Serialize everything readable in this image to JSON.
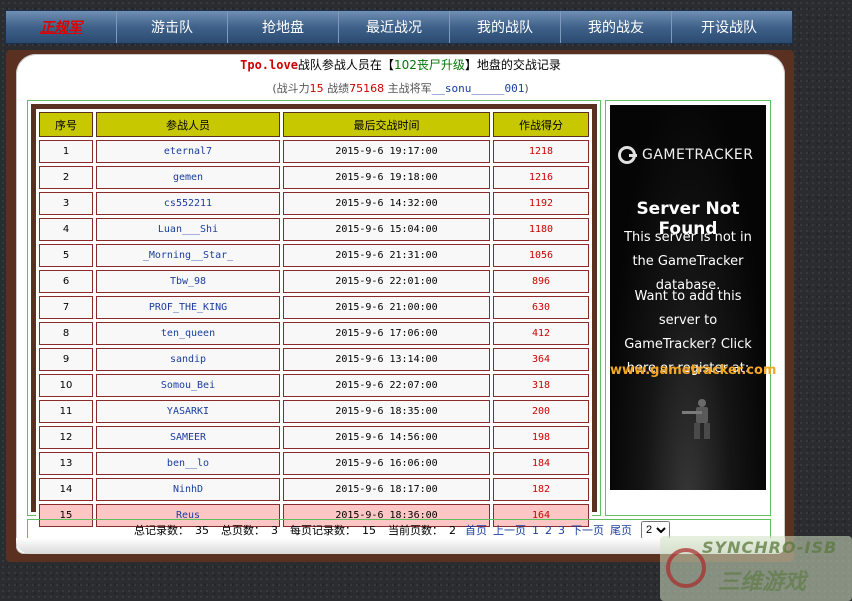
{
  "nav": {
    "items": [
      {
        "label": "正规军",
        "brand": true
      },
      {
        "label": "游击队"
      },
      {
        "label": "抢地盘"
      },
      {
        "label": "最近战况"
      },
      {
        "label": "我的战队"
      },
      {
        "label": "我的战友"
      },
      {
        "label": "开设战队"
      }
    ]
  },
  "header": {
    "team": "Tpo.love",
    "text1": "战队参战人员在【",
    "map": "102丧尸升级",
    "text2": "】地盘的交战记录"
  },
  "subheader": {
    "open": "(战斗力",
    "power": "15",
    "record_label": " 战绩",
    "record": "75168",
    "general_label": " 主战将军",
    "general": "__sonu_____001",
    "close": ")"
  },
  "table": {
    "columns": [
      "序号",
      "参战人员",
      "最后交战时间",
      "作战得分"
    ],
    "rows": [
      {
        "idx": "1",
        "player": "eternal7",
        "time": "2015-9-6 19:17:00",
        "score": "1218"
      },
      {
        "idx": "2",
        "player": "gemen",
        "time": "2015-9-6 19:18:00",
        "score": "1216"
      },
      {
        "idx": "3",
        "player": "cs552211",
        "time": "2015-9-6 14:32:00",
        "score": "1192"
      },
      {
        "idx": "4",
        "player": "Luan___Shi",
        "time": "2015-9-6 15:04:00",
        "score": "1180"
      },
      {
        "idx": "5",
        "player": "_Morning__Star_",
        "time": "2015-9-6 21:31:00",
        "score": "1056"
      },
      {
        "idx": "6",
        "player": "Tbw_98",
        "time": "2015-9-6 22:01:00",
        "score": "896"
      },
      {
        "idx": "7",
        "player": "PROF_THE_KING",
        "time": "2015-9-6 21:00:00",
        "score": "630"
      },
      {
        "idx": "8",
        "player": "ten_queen",
        "time": "2015-9-6 17:06:00",
        "score": "412"
      },
      {
        "idx": "9",
        "player": "sandip",
        "time": "2015-9-6 13:14:00",
        "score": "364"
      },
      {
        "idx": "10",
        "player": "Somou_Bei",
        "time": "2015-9-6 22:07:00",
        "score": "318"
      },
      {
        "idx": "11",
        "player": "YASARKI",
        "time": "2015-9-6 18:35:00",
        "score": "200"
      },
      {
        "idx": "12",
        "player": "SAMEER",
        "time": "2015-9-6 14:56:00",
        "score": "198"
      },
      {
        "idx": "13",
        "player": "ben__lo",
        "time": "2015-9-6 16:06:00",
        "score": "184"
      },
      {
        "idx": "14",
        "player": "NinhD",
        "time": "2015-9-6 18:17:00",
        "score": "182"
      },
      {
        "idx": "15",
        "player": "Reus",
        "time": "2015-9-6 18:36:00",
        "score": "164",
        "highlight": true
      }
    ]
  },
  "ad": {
    "brand": "GAMETRACKER",
    "heading": "Server Not Found",
    "line1": "This server is not in the GameTracker database.",
    "line2": "Want to add this server to GameTracker? Click here or register at:",
    "url": "www.gametracker.com"
  },
  "pager": {
    "total_label": "总记录数：",
    "total": "35",
    "pages_label": "总页数：",
    "pages": "3",
    "per_page_label": "每页记录数：",
    "per_page": "15",
    "current_label": "当前页数：",
    "current": "2",
    "first": "首页",
    "prev": "上一页",
    "page_links": [
      "1",
      "2",
      "3"
    ],
    "next": "下一页",
    "last": "尾页",
    "select_value": "2"
  },
  "watermark": {
    "line1": "SYNCHRO-ISB",
    "line2": "三维游戏"
  }
}
